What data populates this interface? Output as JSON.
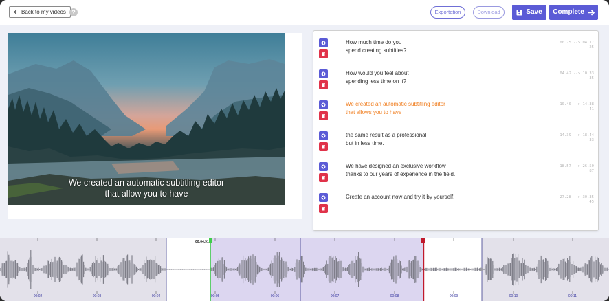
{
  "header": {
    "back_label": "Back to my videos",
    "help_label": "?",
    "export_label": "Exportation",
    "download_label": "Download",
    "save_label": "Save",
    "complete_label": "Complete"
  },
  "video": {
    "subtitle_line1": "We created an automatic subtitling editor",
    "subtitle_line2": "that allow you to have"
  },
  "subtitles": [
    {
      "text": "How much time do you\nspend creating subtitles?",
      "time": "00.75 --> 04.17",
      "count": "25",
      "active": false
    },
    {
      "text": "How would you feel about\nspending less time on it?",
      "time": "04.42 --> 10.33",
      "count": "35",
      "active": false
    },
    {
      "text": "We created an automatic subtitling editor\nthat allows you to have",
      "time": "10.40 --> 14.38",
      "count": "41",
      "active": true
    },
    {
      "text": "the same result as a professional\nbut in less time.",
      "time": "14.39 --> 18.44",
      "count": "33",
      "active": false
    },
    {
      "text": "We have designed an exclusive workflow\nthanks to our years of experience in the field.",
      "time": "18.57 --> 26.50",
      "count": "87",
      "active": false
    },
    {
      "text": "Create an account now and try it by yourself.",
      "time": "27.28 --> 30.35",
      "count": "45",
      "active": false
    }
  ],
  "timeline": {
    "cursor_time": "00:04.91",
    "ticks": [
      "00:02",
      "00:03",
      "00:04",
      "00:05",
      "00:06",
      "00:07",
      "00:08",
      "00:09",
      "00:10",
      "00:11"
    ]
  },
  "colors": {
    "accent": "#5b5bd6",
    "active_text": "#f07d1e",
    "delete": "#e0334a",
    "region_fill": "#dcd6f0",
    "cursor_start": "#3fcc4a",
    "cursor_end": "#c0192c"
  }
}
